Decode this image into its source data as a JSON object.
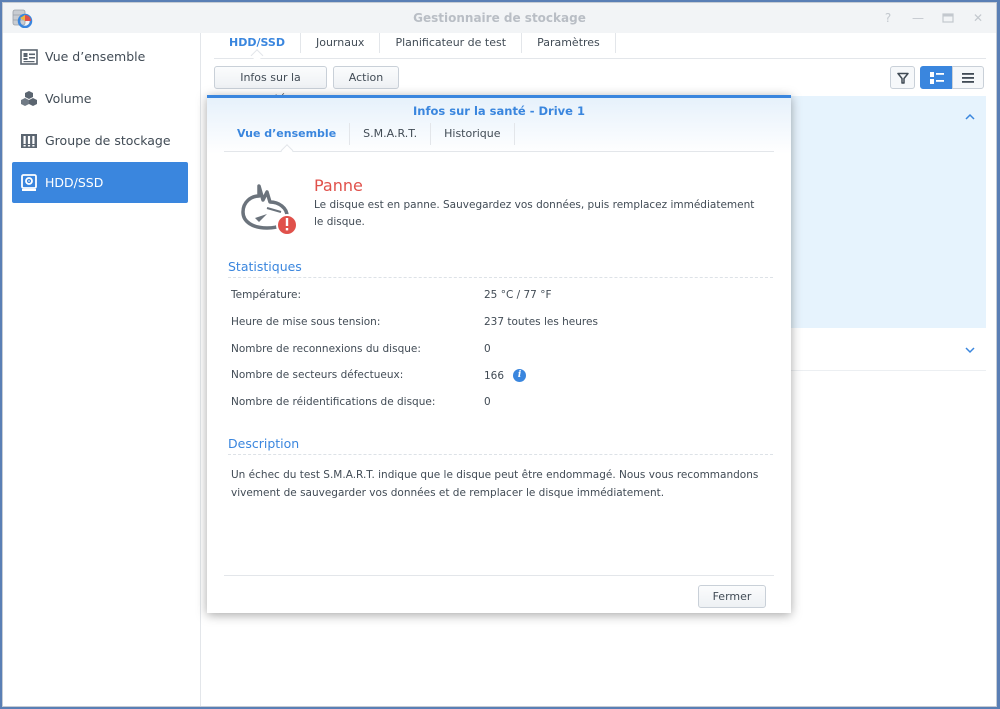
{
  "window": {
    "title": "Gestionnaire de stockage",
    "controls": [
      "help",
      "minimize",
      "maximize",
      "close"
    ]
  },
  "sidebar": {
    "items": [
      {
        "label": "Vue d’ensemble",
        "icon": "overview-icon",
        "active": false
      },
      {
        "label": "Volume",
        "icon": "volume-cubes-icon",
        "active": false
      },
      {
        "label": "Groupe de stockage",
        "icon": "storage-pool-icon",
        "active": false
      },
      {
        "label": "HDD/SSD",
        "icon": "hdd-icon",
        "active": true
      }
    ]
  },
  "main": {
    "tabs": [
      {
        "label": "HDD/SSD",
        "active": true
      },
      {
        "label": "Journaux",
        "active": false
      },
      {
        "label": "Planificateur de test",
        "active": false
      },
      {
        "label": "Paramètres",
        "active": false
      }
    ],
    "toolbar": {
      "health_info_label": "Infos sur la santé",
      "action_label": "Action",
      "filter_icon": "filter-icon",
      "view_modes": [
        "detail-list-view",
        "list-view"
      ],
      "active_view": "detail-list-view"
    }
  },
  "dialog": {
    "title": "Infos sur la santé - Drive 1",
    "tabs": [
      {
        "label": "Vue d’ensemble",
        "active": true
      },
      {
        "label": "S.M.A.R.T.",
        "active": false
      },
      {
        "label": "Historique",
        "active": false
      }
    ],
    "status": {
      "title": "Panne",
      "message": "Le disque est en panne. Sauvegardez vos données, puis remplacez immédiatement le disque.",
      "color": "#e0514b"
    },
    "statistics": {
      "heading": "Statistiques",
      "rows": [
        {
          "label": "Température:",
          "value": "25 °C / 77 °F"
        },
        {
          "label": "Heure de mise sous tension:",
          "value": "237 toutes les heures"
        },
        {
          "label": "Nombre de reconnexions du disque:",
          "value": "0"
        },
        {
          "label": "Nombre de secteurs défectueux:",
          "value": "166",
          "has_info": true
        },
        {
          "label": "Nombre de réidentifications de disque:",
          "value": "0"
        }
      ]
    },
    "description": {
      "heading": "Description",
      "text": "Un échec du test S.M.A.R.T. indique que le disque peut être endommagé. Nous vous recommandons vivement de sauvegarder vos données et de remplacer le disque immédiatement."
    },
    "close_label": "Fermer"
  },
  "colors": {
    "accent": "#3a86de",
    "error": "#e0514b",
    "selected_row_bg": "#e6f3fd"
  }
}
